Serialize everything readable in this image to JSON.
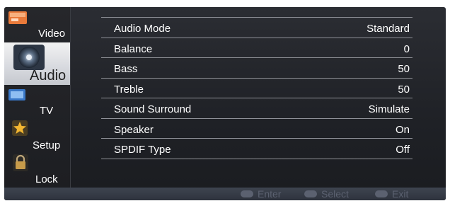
{
  "sidebar": {
    "items": [
      {
        "label": "Video",
        "icon": "video-icon"
      },
      {
        "label": "Audio",
        "icon": "speaker-icon",
        "selected": true
      },
      {
        "label": "TV",
        "icon": "tv-icon"
      },
      {
        "label": "Setup",
        "icon": "star-icon"
      },
      {
        "label": "Lock",
        "icon": "padlock-icon"
      }
    ]
  },
  "menu": {
    "rows": [
      {
        "name": "Audio Mode",
        "value": "Standard"
      },
      {
        "name": "Balance",
        "value": "0"
      },
      {
        "name": "Bass",
        "value": "50"
      },
      {
        "name": "Treble",
        "value": "50"
      },
      {
        "name": "Sound Surround",
        "value": "Simulate"
      },
      {
        "name": "Speaker",
        "value": "On"
      },
      {
        "name": "SPDIF Type",
        "value": "Off"
      }
    ]
  },
  "footer": {
    "hints": [
      {
        "label": "Enter",
        "icon": "ok-button-icon"
      },
      {
        "label": "Select",
        "icon": "dpad-button-icon"
      },
      {
        "label": "Exit",
        "icon": "exit-button-icon"
      }
    ]
  }
}
